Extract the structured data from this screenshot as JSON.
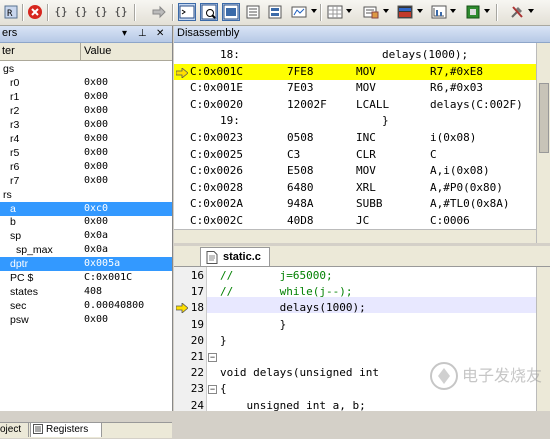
{
  "toolbar": {
    "icons": [
      "toolbar-button",
      "reset-icon",
      "step-into-icon",
      "step-over-icon",
      "step-out-icon",
      "run-to-cursor-icon",
      "show-next-icon",
      "command-window-icon",
      "disassembly-window-icon",
      "symbols-window-icon",
      "registers-window-icon",
      "call-stack-icon",
      "watch-window-icon",
      "memory-window-icon",
      "serial-window-icon",
      "analysis-window-icon",
      "trace-window-icon",
      "system-viewer-icon",
      "toolbox-icon"
    ],
    "brace_glyphs": [
      "{}",
      "{}",
      "{}",
      "{}"
    ]
  },
  "left_panel": {
    "title": "ers",
    "columns": [
      "ter",
      "Value"
    ],
    "rows": [
      {
        "name": "gs",
        "value": "",
        "indent": 3,
        "selected": false
      },
      {
        "name": "r0",
        "value": "0x00",
        "indent": 10,
        "selected": false
      },
      {
        "name": "r1",
        "value": "0x00",
        "indent": 10,
        "selected": false
      },
      {
        "name": "r2",
        "value": "0x00",
        "indent": 10,
        "selected": false
      },
      {
        "name": "r3",
        "value": "0x00",
        "indent": 10,
        "selected": false
      },
      {
        "name": "r4",
        "value": "0x00",
        "indent": 10,
        "selected": false
      },
      {
        "name": "r5",
        "value": "0x00",
        "indent": 10,
        "selected": false
      },
      {
        "name": "r6",
        "value": "0x00",
        "indent": 10,
        "selected": false
      },
      {
        "name": "r7",
        "value": "0x00",
        "indent": 10,
        "selected": false
      },
      {
        "name": "rs",
        "value": "",
        "indent": 3,
        "selected": false
      },
      {
        "name": "a",
        "value": "0xc0",
        "indent": 10,
        "selected": true
      },
      {
        "name": "b",
        "value": "0x00",
        "indent": 10,
        "selected": false
      },
      {
        "name": "sp",
        "value": "0x0a",
        "indent": 10,
        "selected": false
      },
      {
        "name": "sp_max",
        "value": "0x0a",
        "indent": 16,
        "selected": false
      },
      {
        "name": "dptr",
        "value": "0x005a",
        "indent": 10,
        "selected": true
      },
      {
        "name": "PC  $",
        "value": "C:0x001C",
        "indent": 10,
        "selected": false
      },
      {
        "name": "states",
        "value": "408",
        "indent": 10,
        "selected": false
      },
      {
        "name": "sec",
        "value": "0.00040800",
        "indent": 10,
        "selected": false
      },
      {
        "name": "psw",
        "value": "0x00",
        "indent": 10,
        "selected": false
      }
    ],
    "tabs": [
      "oject",
      "Registers"
    ]
  },
  "disassembly": {
    "title": "Disassembly",
    "rows": [
      {
        "addr": "",
        "code": "18:",
        "mnem": "",
        "ops": "delays(1000);",
        "current": false,
        "src": true
      },
      {
        "addr": "C:0x001C",
        "code": "7FE8",
        "mnem": "MOV",
        "ops": "R7,#0xE8",
        "current": true,
        "src": false
      },
      {
        "addr": "C:0x001E",
        "code": "7E03",
        "mnem": "MOV",
        "ops": "R6,#0x03",
        "current": false,
        "src": false
      },
      {
        "addr": "C:0x0020",
        "code": "12002F",
        "mnem": "LCALL",
        "ops": "delays(C:002F)",
        "current": false,
        "src": false
      },
      {
        "addr": "",
        "code": "19:",
        "mnem": "",
        "ops": "}",
        "current": false,
        "src": true
      },
      {
        "addr": "C:0x0023",
        "code": "0508",
        "mnem": "INC",
        "ops": "i(0x08)",
        "current": false,
        "src": false
      },
      {
        "addr": "C:0x0025",
        "code": "C3",
        "mnem": "CLR",
        "ops": "C",
        "current": false,
        "src": false
      },
      {
        "addr": "C:0x0026",
        "code": "E508",
        "mnem": "MOV",
        "ops": "A,i(0x08)",
        "current": false,
        "src": false
      },
      {
        "addr": "C:0x0028",
        "code": "6480",
        "mnem": "XRL",
        "ops": "A,#P0(0x80)",
        "current": false,
        "src": false
      },
      {
        "addr": "C:0x002A",
        "code": "948A",
        "mnem": "SUBB",
        "ops": "A,#TL0(0x8A)",
        "current": false,
        "src": false
      },
      {
        "addr": "C:0x002C",
        "code": "40D8",
        "mnem": "JC",
        "ops": "C:0006",
        "current": false,
        "src": false
      }
    ]
  },
  "editor": {
    "tab_label": "static.c",
    "lines": [
      {
        "num": "16",
        "text": "//       j=65000;",
        "comment": true
      },
      {
        "num": "17",
        "text": "//       while(j--);",
        "comment": true
      },
      {
        "num": "18",
        "text": "         delays(1000);",
        "comment": false
      },
      {
        "num": "19",
        "text": "         }",
        "comment": false
      },
      {
        "num": "20",
        "text": "}",
        "comment": false
      },
      {
        "num": "21",
        "text": "",
        "comment": false
      },
      {
        "num": "22",
        "text": "void delays(unsigned int",
        "comment": false
      },
      {
        "num": "23",
        "text": "{",
        "comment": false
      },
      {
        "num": "24",
        "text": "    unsigned int a, b;",
        "comment": false
      }
    ],
    "current_line": "18"
  },
  "watermark": {
    "text": "电子发烧友"
  },
  "colors": {
    "current_line": "#ffff00",
    "selection": "#3399ff",
    "comment": "#008000"
  }
}
